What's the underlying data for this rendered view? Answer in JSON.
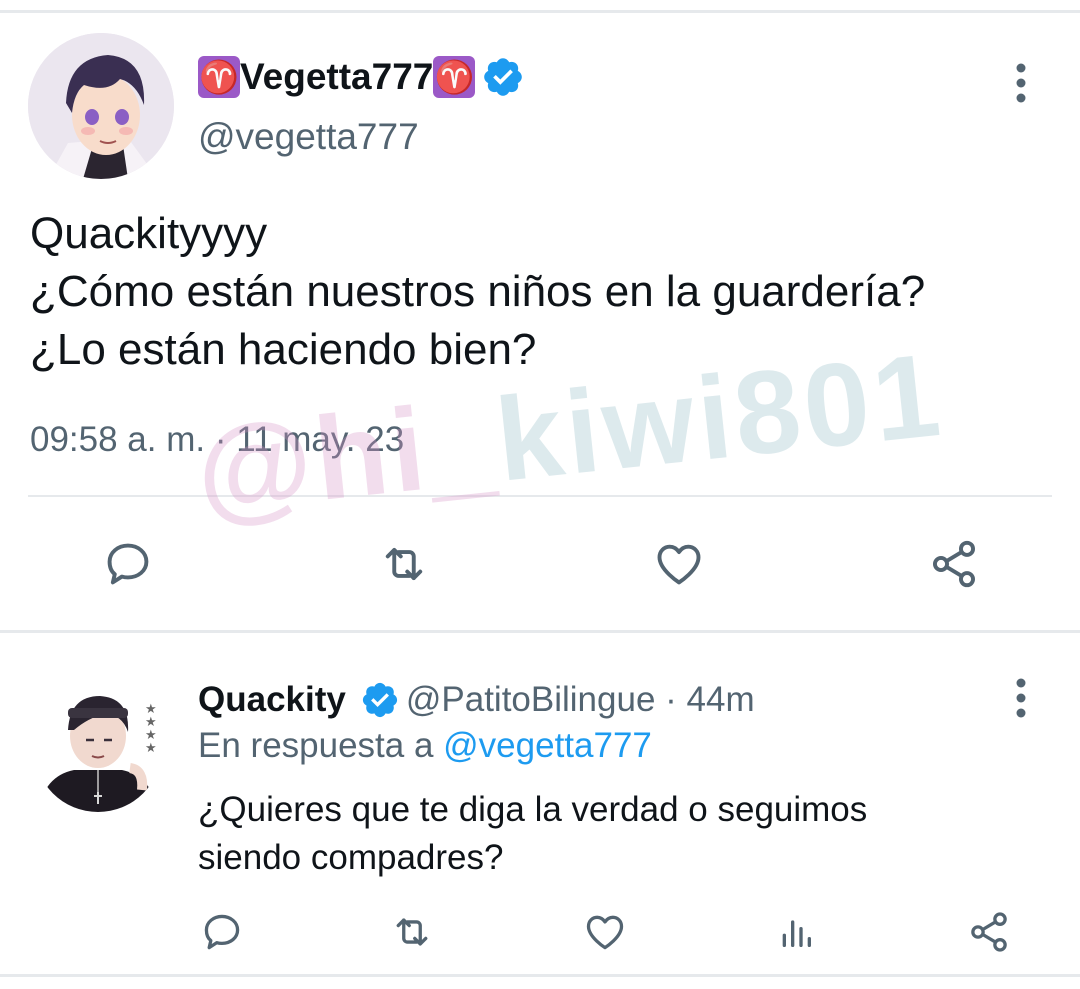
{
  "main_tweet": {
    "display_name": "Vegetta777",
    "name_emoji": "♈",
    "handle": "@vegetta777",
    "text_lines": [
      "Quackityyyy",
      "¿Cómo están nuestros niños en la guardería?",
      "¿Lo están haciendo bien?"
    ],
    "timestamp": "09:58 a. m. · 11 may. 23",
    "actions": [
      "reply-icon",
      "retweet-icon",
      "like-icon",
      "share-icon"
    ]
  },
  "watermark": {
    "part1": "@hi_",
    "part2": "kiwi801"
  },
  "reply_tweet": {
    "display_name": "Quackity",
    "handle": "@PatitoBilingue",
    "separator": " · ",
    "time": "44m",
    "reply_prefix": "En respuesta a ",
    "reply_mention": "@vegetta777",
    "text_lines": [
      "¿Quieres que te diga la verdad o seguimos",
      "siendo compadres?"
    ],
    "actions": [
      "reply-icon",
      "retweet-icon",
      "like-icon",
      "views-icon",
      "share-icon"
    ]
  },
  "colors": {
    "text": "#0f1419",
    "secondary": "#536471",
    "link": "#1d9bf0",
    "verified": "#1d9bf0",
    "divider": "#e6e9ec",
    "aries_badge": "#9b59c7"
  }
}
